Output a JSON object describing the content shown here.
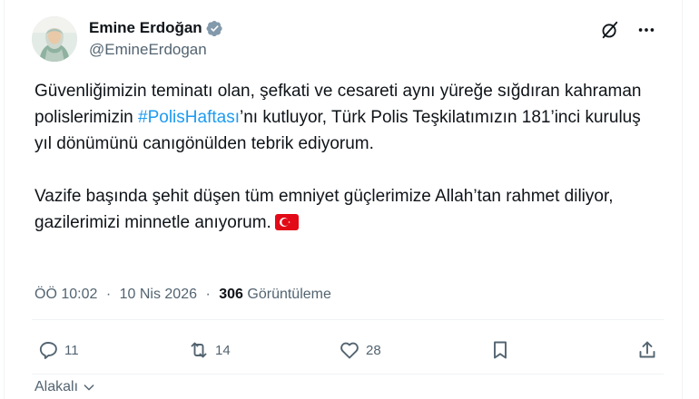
{
  "author": {
    "display_name": "Emine Erdoğan",
    "handle": "@EmineErdogan",
    "avatar_icon": "portrait-avatar",
    "verified_icon": "verified-badge-icon",
    "verified_color": "#829aab"
  },
  "header_actions": {
    "grok_icon": "grok-icon",
    "more_icon": "more-dots-icon"
  },
  "tweet": {
    "p1_before": "Güvenliğimizin teminatı olan, şefkati ve cesareti aynı yüreğe sığdıran kahraman polislerimizin ",
    "hashtag": "#PolisHaftası",
    "p1_after": "’nı kutluyor, Türk Polis Teşkilatımızın 181’inci kuruluş yıl dönümünü canıgönülden tebrik ediyorum.",
    "p2": "Vazife başında şehit düşen tüm emniyet güçlerimize Allah’tan rahmet diliyor, gazilerimizi minnetle anıyorum.",
    "flag_icon": "turkey-flag-emoji",
    "hashtag_color": "#1d9bf0"
  },
  "meta": {
    "time": "ÖÖ 10:02",
    "date": "10 Nis 2026",
    "separator": "·",
    "views_count": "306",
    "views_label": "Görüntüleme"
  },
  "actions": {
    "reply_count": "11",
    "retweet_count": "14",
    "like_count": "28",
    "bookmark_icon": "bookmark-icon",
    "share_icon": "share-icon"
  },
  "related": {
    "label": "Alakalı",
    "icon": "chevron-down-icon"
  }
}
